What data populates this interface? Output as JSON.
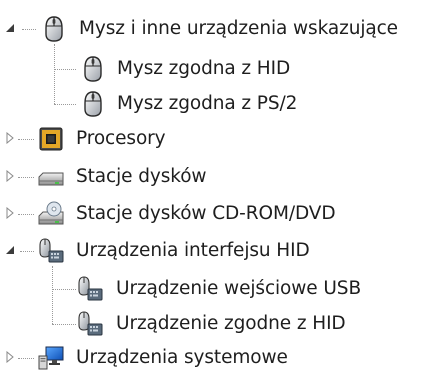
{
  "tree": {
    "mice": {
      "label": "Mysz i inne urządzenia wskazujące",
      "expanded": true,
      "icon": "mouse-icon",
      "children": [
        {
          "label": "Mysz zgodna z HID",
          "icon": "mouse-icon"
        },
        {
          "label": "Mysz zgodna z PS/2",
          "icon": "mouse-icon"
        }
      ]
    },
    "processors": {
      "label": "Procesory",
      "expanded": false,
      "icon": "processor-icon"
    },
    "disk_drives": {
      "label": "Stacje dysków",
      "expanded": false,
      "icon": "disk-drive-icon"
    },
    "dvd_drives": {
      "label": "Stacje dysków CD-ROM/DVD",
      "expanded": false,
      "icon": "dvd-drive-icon"
    },
    "hid": {
      "label": "Urządzenia interfejsu HID",
      "expanded": true,
      "icon": "hid-device-icon",
      "children": [
        {
          "label": "Urządzenie wejściowe USB",
          "icon": "hid-device-icon"
        },
        {
          "label": "Urządzenie zgodne z HID",
          "icon": "hid-device-icon"
        }
      ]
    },
    "system_devices": {
      "label": "Urządzenia systemowe",
      "expanded": false,
      "icon": "system-device-icon"
    }
  }
}
